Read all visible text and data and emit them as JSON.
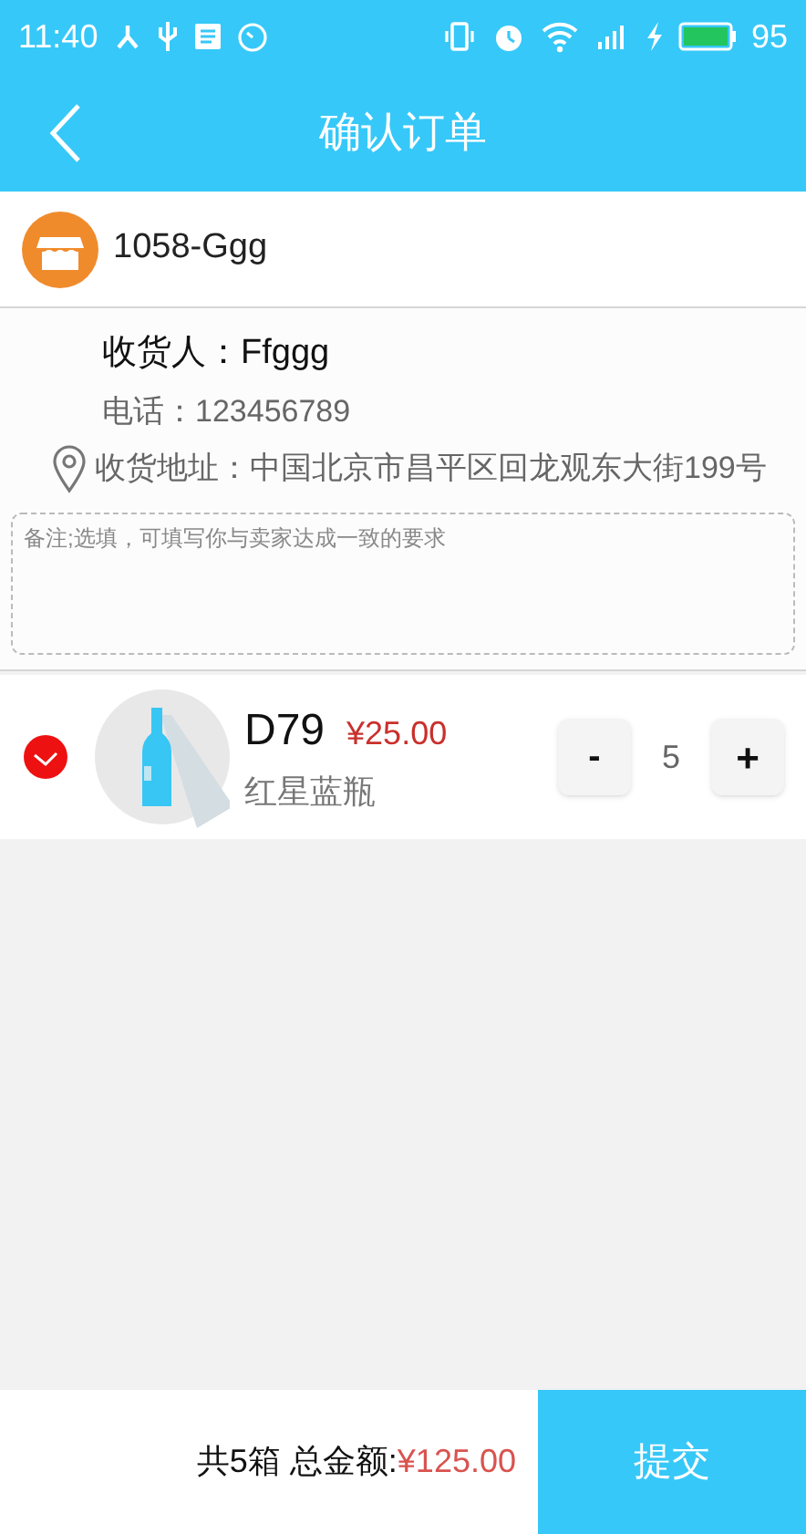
{
  "status_bar": {
    "time": "11:40",
    "battery": "95"
  },
  "header": {
    "title": "确认订单"
  },
  "store": {
    "name": "1058-Ggg"
  },
  "address": {
    "recipient": "收货人：Ffggg",
    "phone": "电话：123456789",
    "address": "收货地址：中国北京市昌平区回龙观东大街199号"
  },
  "note": {
    "placeholder": "备注;选填，可填写你与卖家达成一致的要求"
  },
  "items": [
    {
      "code": "D79",
      "price": "¥25.00",
      "name": "红星蓝瓶",
      "checked": true,
      "quantity": "5",
      "minus": "-",
      "plus": "+"
    }
  ],
  "footer": {
    "summary": "共5箱 总金额:",
    "total": "¥125.00",
    "submit": "提交"
  }
}
